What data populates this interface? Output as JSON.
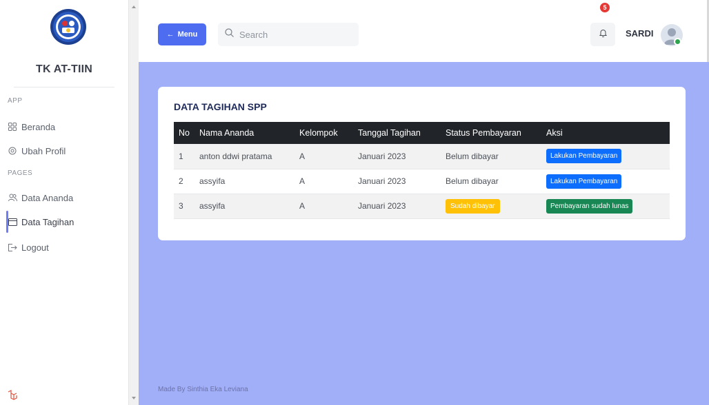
{
  "sidebar": {
    "brand": "TK AT-TIIN",
    "section_app": "APP",
    "section_pages": "PAGES",
    "items": [
      {
        "label": "Beranda",
        "icon": "grid-icon"
      },
      {
        "label": "Ubah Profil",
        "icon": "gear-icon"
      },
      {
        "label": "Data Ananda",
        "icon": "users-icon"
      },
      {
        "label": "Data Tagihan",
        "icon": "credit-card-icon"
      },
      {
        "label": "Logout",
        "icon": "logout-icon"
      }
    ],
    "active": "Data Tagihan"
  },
  "topbar": {
    "menu_label": "Menu",
    "search_placeholder": "Search",
    "notification_count": "5",
    "username": "SARDI"
  },
  "card": {
    "title": "DATA TAGIHAN SPP",
    "columns": [
      "No",
      "Nama Ananda",
      "Kelompok",
      "Tanggal Tagihan",
      "Status Pembayaran",
      "Aksi"
    ],
    "rows": [
      {
        "no": "1",
        "nama": "anton ddwi pratama",
        "kelompok": "A",
        "tanggal": "Januari 2023",
        "status": "Belum dibayar",
        "aksi": "Lakukan Pembayaran"
      },
      {
        "no": "2",
        "nama": "assyifa",
        "kelompok": "A",
        "tanggal": "Januari 2023",
        "status": "Belum dibayar",
        "aksi": "Lakukan Pembayaran"
      },
      {
        "no": "3",
        "nama": "assyifa",
        "kelompok": "A",
        "tanggal": "Januari 2023",
        "status": "Sudah dibayar",
        "aksi": "Pembayaran sudah lunas"
      }
    ]
  },
  "footer": "Made By Sinthia Eka Leviana",
  "colors": {
    "accent": "#4d6cf0",
    "main_bg": "#a1aef8",
    "primary_btn": "#0d6efd",
    "success_btn": "#198754",
    "warning_badge": "#ffc107"
  }
}
